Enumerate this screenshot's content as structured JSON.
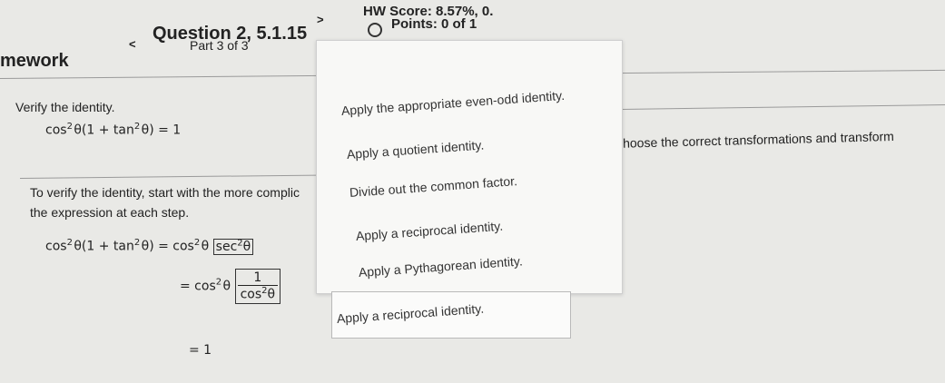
{
  "header": {
    "question_title": "Question 2, 5.1.15",
    "part": "Part 3 of 3",
    "hw_score": "HW Score: 8.57%, 0.",
    "points": "Points: 0 of 1",
    "course_fragment": "mework",
    "prev_arrow": "<",
    "next_arrow": ">"
  },
  "content": {
    "instruction": "Verify the identity.",
    "identity_lhs": "cos",
    "identity_rest": "θ(1 + tan",
    "identity_end": "θ) = 1",
    "exp2": "2",
    "steps_intro_line1": "To verify the identity, start with the more complic",
    "steps_intro_line2": "the expression at each step.",
    "step1_prefix": "cos",
    "step1_mid": "θ(1 + tan",
    "step1_eq": "θ) = cos",
    "step1_theta": "θ",
    "step1_boxed": "sec",
    "step1_boxed_theta": "θ",
    "step2_prefix": "= cos",
    "step2_theta": "θ",
    "step2_num": "1",
    "step2_den": "cos",
    "step2_den_theta": "θ",
    "step3": "= 1",
    "choose_text": "Choose the correct transformations and transform"
  },
  "dropdown": {
    "options": [
      "Apply the appropriate even-odd identity.",
      "Apply a quotient identity.",
      "Divide out the common factor.",
      "Apply a reciprocal identity.",
      "Apply a Pythagorean identity."
    ],
    "selected": "Apply a reciprocal identity."
  }
}
